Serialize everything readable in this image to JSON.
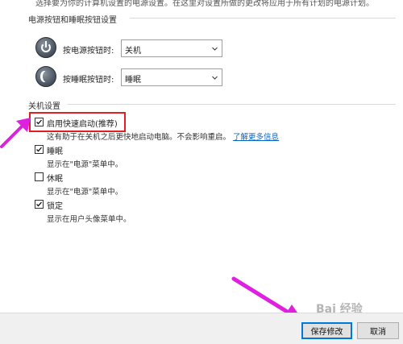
{
  "header": {
    "cut_off_text": "选择要为你的计算机设置的电源设置。在这里对设置所做的更改将应用于所有计划的电源计划。"
  },
  "power_section": {
    "title": "电源按钮和睡眠按钮设置",
    "rows": [
      {
        "label": "按电源按钮时:",
        "value": "关机",
        "icon": "power-icon"
      },
      {
        "label": "按睡眠按钮时:",
        "value": "睡眠",
        "icon": "moon-icon"
      }
    ]
  },
  "shutdown_section": {
    "title": "关机设置",
    "options": [
      {
        "label": "启用快速启动(推荐)",
        "checked": true,
        "description": "这有助于在关机之后更快地启动电脑。不会影响重启。",
        "link": "了解更多信息"
      },
      {
        "label": "睡眠",
        "checked": true,
        "description": "显示在\"电源\"菜单中。"
      },
      {
        "label": "休眠",
        "checked": false,
        "description": "显示在\"电源\"菜单中。"
      },
      {
        "label": "锁定",
        "checked": true,
        "description": "显示在用户头像菜单中。"
      }
    ]
  },
  "footer": {
    "save_label": "保存修改",
    "cancel_label": "取消"
  },
  "watermark": "Bai 经验",
  "colors": {
    "highlight": "#e02020",
    "arrow": "#e020e0",
    "link": "#0066cc",
    "primary_border": "#0078d7"
  }
}
